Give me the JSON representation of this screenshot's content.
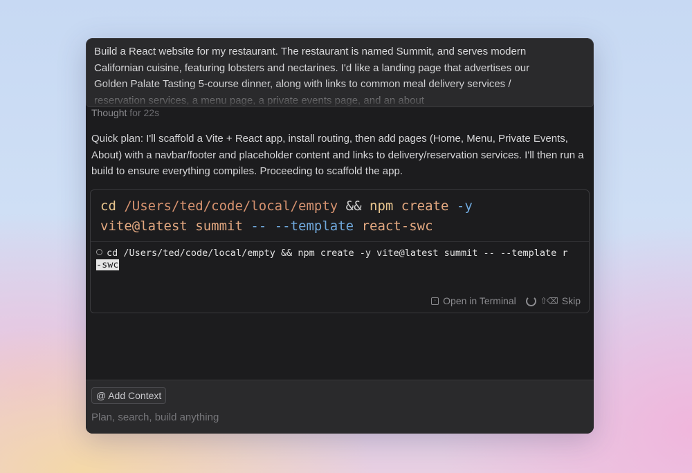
{
  "prompt": {
    "text": "Build a React website for my restaurant. The restaurant is named Summit, and serves modern Californian cuisine, featuring lobsters and nectarines. I'd like a landing page that advertises our Golden Palate Tasting 5-course dinner, along with links to common meal delivery services / reservation services, a menu page, a private events page, and an about"
  },
  "thought": {
    "label": "Thought",
    "duration": "for 22s"
  },
  "plan": {
    "text": "Quick plan: I'll scaffold a Vite + React app, install routing, then add pages (Home, Menu, Private Events, About) with a navbar/footer and placeholder content and links to delivery/reservation services. I'll then run a build to ensure everything compiles. Proceeding to scaffold the app."
  },
  "command": {
    "tokens": {
      "cd": "cd",
      "path": "/Users/ted/code/local/empty",
      "and": "&&",
      "npm": "npm",
      "create": "create",
      "flag_y": "-y",
      "pkg": "vite@latest",
      "name": "summit",
      "dashdash": "--",
      "template_flag": "--template",
      "template": "react-swc"
    },
    "terminal_line1": "cd /Users/ted/code/local/empty && npm create -y vite@latest summit -- --template r",
    "terminal_line2": "-swc"
  },
  "tool_actions": {
    "open_terminal": "Open in Terminal",
    "skip_shortcut": "⇧⌫",
    "skip": "Skip"
  },
  "composer": {
    "add_context": "Add Context",
    "placeholder": "Plan, search, build anything"
  }
}
